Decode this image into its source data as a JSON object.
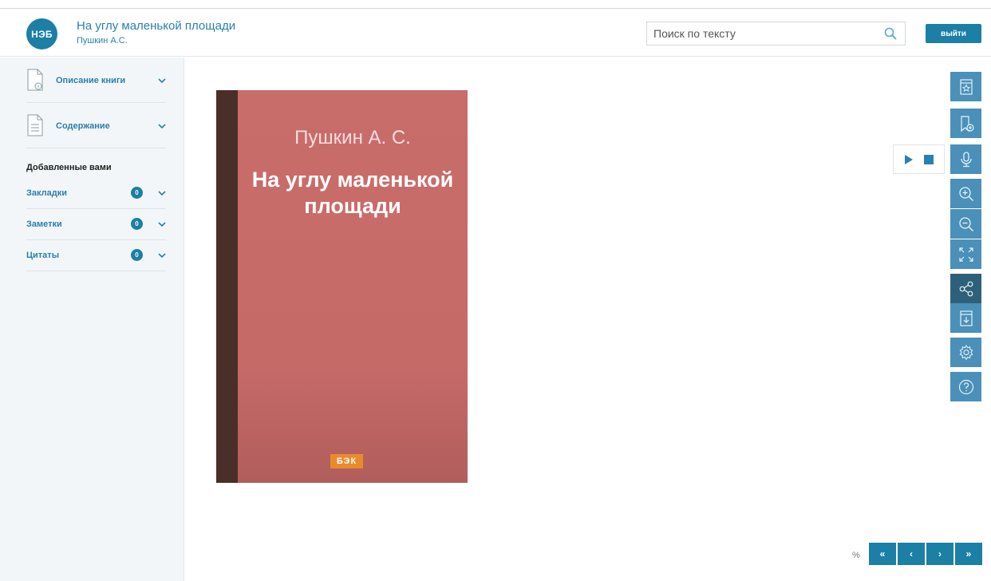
{
  "header": {
    "logo_text": "НЭБ",
    "book_title": "На углу маленькой площади",
    "book_author": "Пушкин А.С.",
    "search_placeholder": "Поиск по тексту",
    "exit_label": "выйти"
  },
  "sidebar": {
    "sections": [
      {
        "label": "Описание книги",
        "icon": "document-info-icon"
      },
      {
        "label": "Содержание",
        "icon": "document-list-icon"
      }
    ],
    "added_title": "Добавленные вами",
    "collections": [
      {
        "label": "Закладки",
        "count": "0"
      },
      {
        "label": "Заметки",
        "count": "0"
      },
      {
        "label": "Цитаты",
        "count": "0"
      }
    ]
  },
  "cover": {
    "author": "Пушкин А. С.",
    "title": "На углу маленькой площади",
    "publisher": "БЭК"
  },
  "toolbar": {
    "buttons": [
      "bookmark-icon",
      "add-bookmark-icon",
      "microphone-icon",
      "zoom-in-icon",
      "zoom-out-icon",
      "fullscreen-icon",
      "share-icon",
      "download-icon",
      "settings-icon",
      "help-icon"
    ]
  },
  "pagination": {
    "percent": "%",
    "first": "«",
    "prev": "‹",
    "next": "›",
    "last": "»"
  },
  "colors": {
    "accent": "#1b7fa6",
    "toolbar": "#4a90b8",
    "toolbar_active": "#2e6179",
    "cover": "#c96d6b",
    "spine": "#4a2e28",
    "publisher_badge": "#e98a2d"
  }
}
